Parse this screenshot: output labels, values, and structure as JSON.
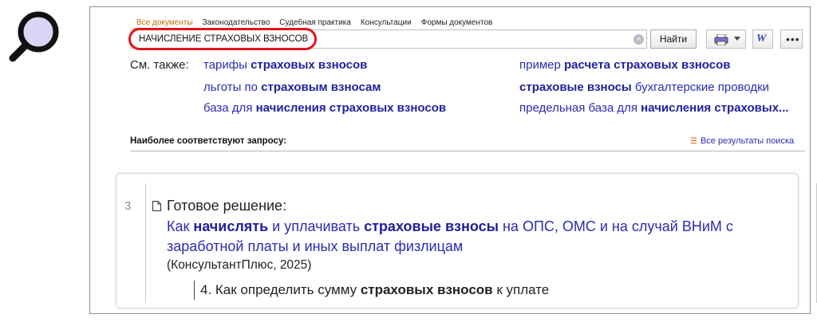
{
  "tabs": [
    "Все документы",
    "Законодательство",
    "Судебная практика",
    "Консультации",
    "Формы документов"
  ],
  "search": {
    "value": "НАЧИСЛЕНИЕ СТРАХОВЫХ ВЗНОСОВ",
    "button_label": "Найти"
  },
  "toolbar": {
    "word_label": "W",
    "more_label": "•••"
  },
  "see_also": {
    "label": "См. также:",
    "items": [
      {
        "pre": "тарифы ",
        "bold": "страховых взносов",
        "post": ""
      },
      {
        "pre": "льготы по ",
        "bold": "страховым взносам",
        "post": ""
      },
      {
        "pre": "база для ",
        "bold": "начисления страховых взносов",
        "post": ""
      },
      {
        "pre": "пример ",
        "bold": "расчета страховых взносов",
        "post": ""
      },
      {
        "pre": "",
        "bold": "страховые взносы",
        "post": " бухгалтерские проводки"
      },
      {
        "pre": "предельная база для ",
        "bold": "начисления страховых...",
        "post": ""
      }
    ]
  },
  "results_header": {
    "title": "Наиболее соответствуют запросу:",
    "all_results": "Все результаты поиска"
  },
  "result": {
    "number": "3",
    "type": "Готовое решение:",
    "title_parts": [
      {
        "t": "Как ",
        "b": false
      },
      {
        "t": "начислять",
        "b": true
      },
      {
        "t": " и уплачивать ",
        "b": false
      },
      {
        "t": "страховые взносы",
        "b": true
      },
      {
        "t": " на ОПС, ОМС и на случай ВНиМ с заработной платы и иных выплат физлицам",
        "b": false
      }
    ],
    "source": "(КонсультантПлюс, 2025)",
    "sub": {
      "pre": "4. Как определить сумму ",
      "bold": "страховых взносов",
      "post": " к уплате"
    }
  },
  "colors": {
    "accent": "#f0a01e",
    "highlight_ring": "#e3141a",
    "link": "#2b2bb3"
  }
}
